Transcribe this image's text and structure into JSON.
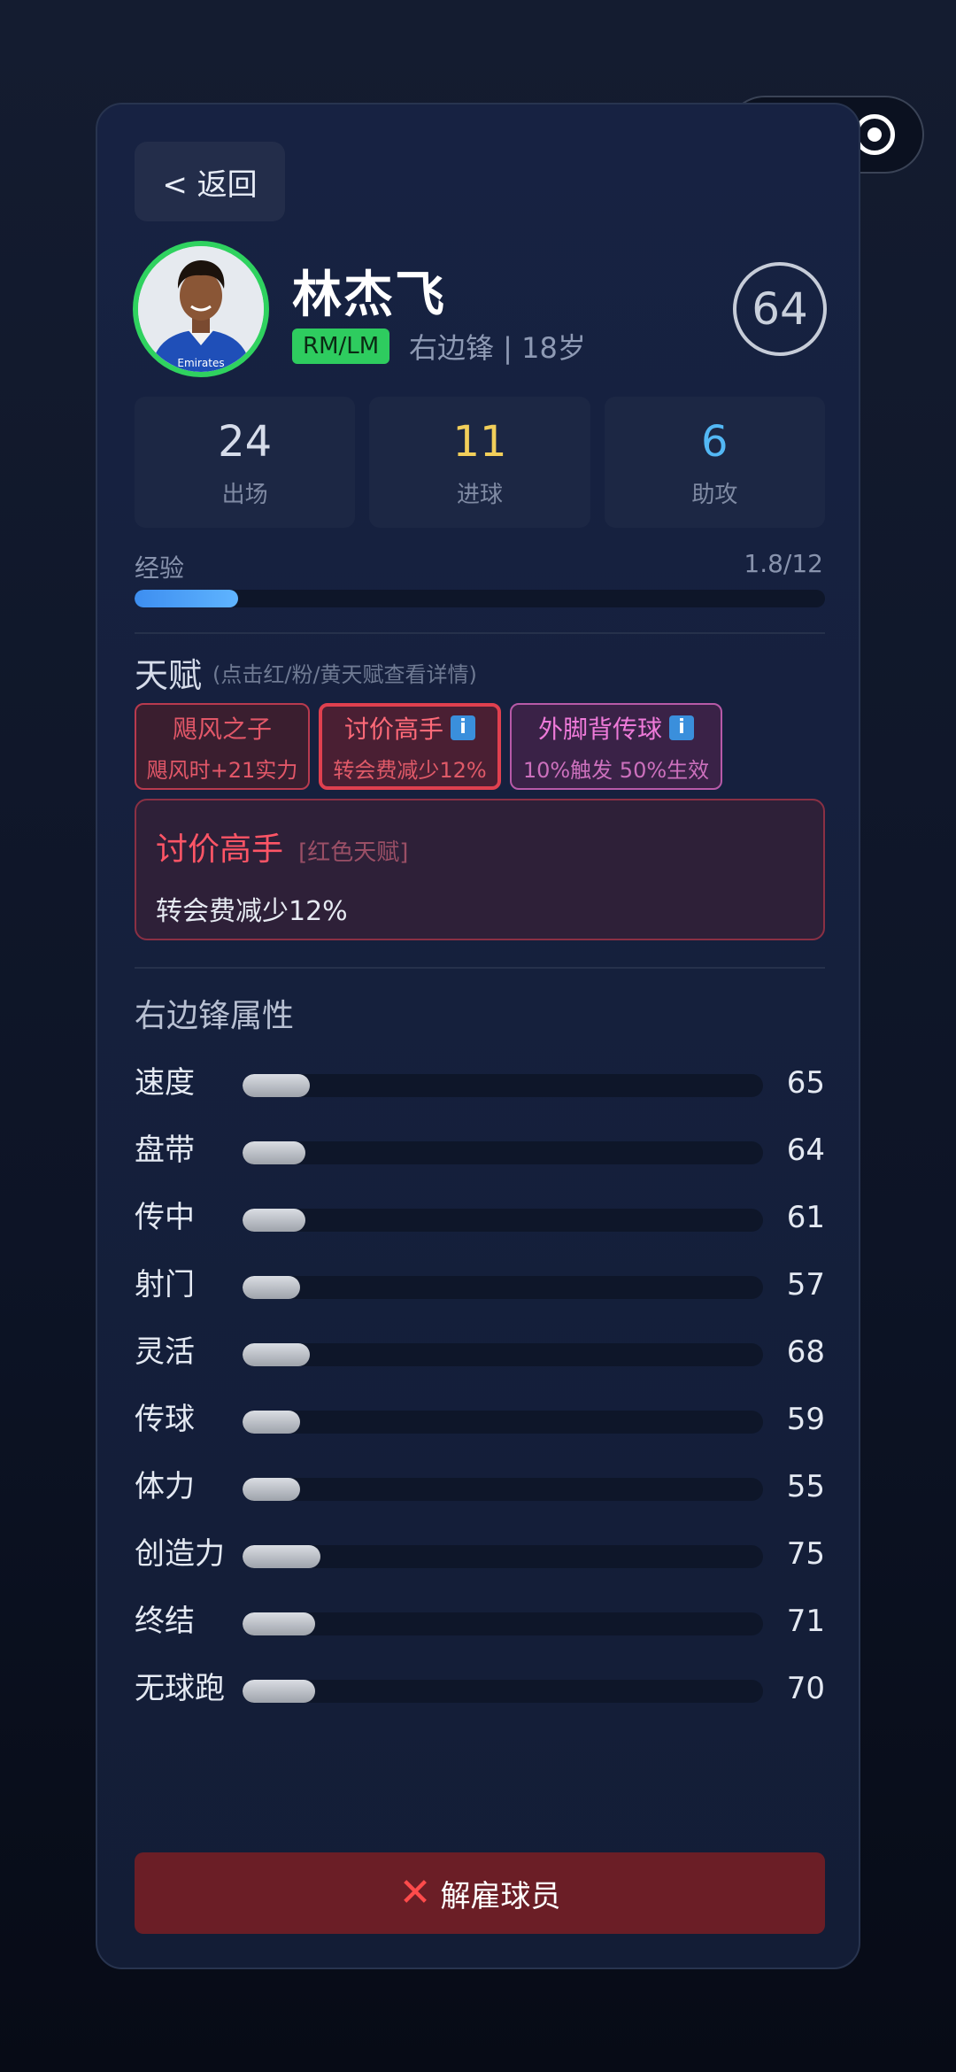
{
  "nav": {
    "back_label": "< 返回"
  },
  "player": {
    "name": "林杰飞",
    "position": "RM/LM",
    "role_age": "右边锋 | 18岁",
    "rating": "64",
    "shirt_text": "Emirates"
  },
  "stats": [
    {
      "value": "24",
      "label": "出场",
      "color": "#d6dcea"
    },
    {
      "value": "11",
      "label": "进球",
      "color": "#f2cf5a"
    },
    {
      "value": "6",
      "label": "助攻",
      "color": "#53b8f5"
    }
  ],
  "experience": {
    "label": "经验",
    "value_text": "1.8/12",
    "progress": 0.15
  },
  "talents": {
    "title": "天赋",
    "hint": "(点击红/粉/黄天赋查看详情)",
    "items": [
      {
        "name": "飓风之子",
        "desc": "飓风时+21实力",
        "info": false
      },
      {
        "name": "讨价高手",
        "desc": "转会费减少12%",
        "info": true
      },
      {
        "name": "外脚背传球",
        "desc": "10%触发 50%生效",
        "info": true
      }
    ],
    "info_glyph": "i",
    "detail": {
      "name": "讨价高手",
      "type": "[红色天赋]",
      "desc": "转会费减少12%"
    }
  },
  "attributes": {
    "title": "右边锋属性",
    "items": [
      {
        "name": "速度",
        "value": 65,
        "fill_pct": 13
      },
      {
        "name": "盘带",
        "value": 64,
        "fill_pct": 12
      },
      {
        "name": "传中",
        "value": 61,
        "fill_pct": 12
      },
      {
        "name": "射门",
        "value": 57,
        "fill_pct": 11
      },
      {
        "name": "灵活",
        "value": 68,
        "fill_pct": 13
      },
      {
        "name": "传球",
        "value": 59,
        "fill_pct": 11
      },
      {
        "name": "体力",
        "value": 55,
        "fill_pct": 11
      },
      {
        "name": "创造力",
        "value": 75,
        "fill_pct": 15
      },
      {
        "name": "终结",
        "value": 71,
        "fill_pct": 14
      },
      {
        "name": "无球跑",
        "value": 70,
        "fill_pct": 14
      }
    ]
  },
  "actions": {
    "fire_label": "解雇球员",
    "fire_icon": "✕"
  },
  "colors": {
    "position_badge": "#2ecc5f",
    "avatar_ring": "#2fd25f",
    "fire_button": "#6b1e26",
    "red_talent": "#e0404f",
    "pink_talent": "#b75aa8"
  }
}
